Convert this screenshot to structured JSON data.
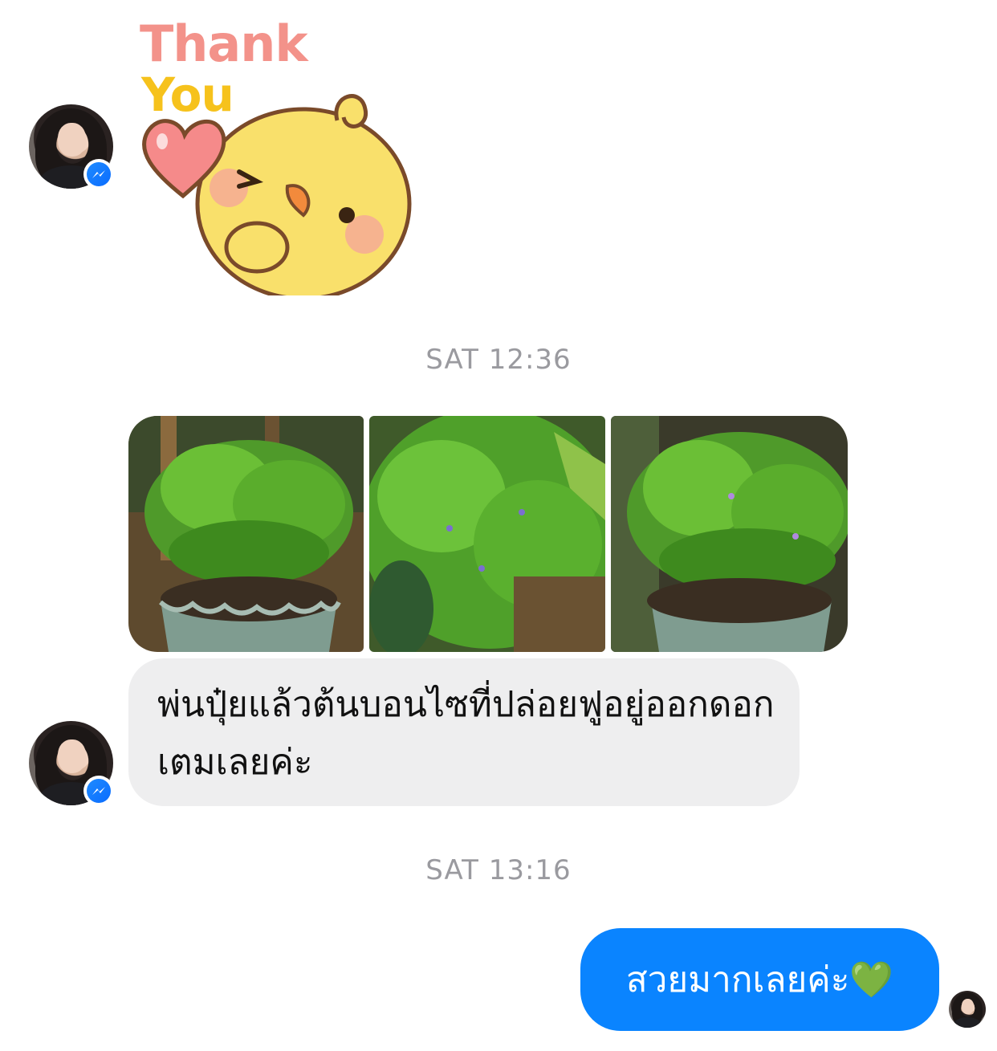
{
  "conversation": {
    "sticker": {
      "line1": "Thank",
      "line2": "You",
      "icon": "thank-you-chick-sticker",
      "colors": {
        "thank": "#f3928a",
        "you": "#f6c21c",
        "chick": "#f9e06b",
        "heart": "#f58a8a"
      }
    },
    "timestamps": [
      "SAT 12:36",
      "SAT 13:16"
    ],
    "photos": [
      {
        "icon": "bonsai-photo-1"
      },
      {
        "icon": "bonsai-photo-2"
      },
      {
        "icon": "bonsai-photo-3"
      }
    ],
    "incoming_message": {
      "text": "พ่นปุ๋ยแล้วต้นบอนไซที่ปล่อยฟูอยู่ออกดอกเตมเลยค่ะ"
    },
    "outgoing_message": {
      "text": "สวยมากเลยค่ะ💚"
    }
  },
  "colors": {
    "outgoing_bubble": "#0a84ff",
    "incoming_bubble": "#eeeeef",
    "timestamp": "#9a9a9f",
    "messenger_badge": "#0a6cff"
  }
}
